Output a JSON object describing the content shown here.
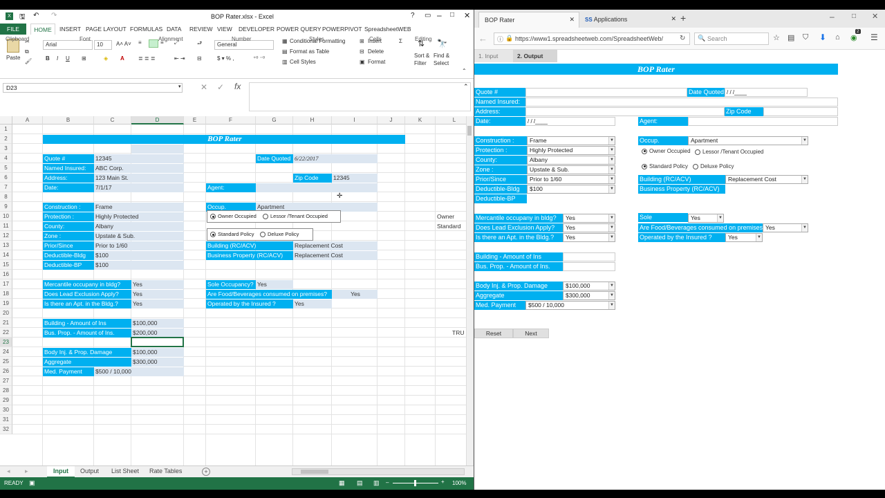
{
  "excel": {
    "window_title": "BOP Rater.xlsx - Excel",
    "ribbon_tabs": [
      "FILE",
      "HOME",
      "INSERT",
      "PAGE LAYOUT",
      "FORMULAS",
      "DATA",
      "REVIEW",
      "VIEW",
      "DEVELOPER",
      "POWER QUERY",
      "POWERPIVOT",
      "SpreadsheetWEB"
    ],
    "active_tab": "HOME",
    "font_name": "Arial",
    "font_size": "10",
    "number_format": "General",
    "groups": {
      "clipboard": "Clipboard",
      "font": "Font",
      "alignment": "Alignment",
      "number": "Number",
      "styles": "Styles",
      "cells": "Cells",
      "editing": "Editing"
    },
    "buttons": {
      "paste": "Paste",
      "conditional": "Conditional Formatting",
      "format_table": "Format as Table",
      "cell_styles": "Cell Styles",
      "insert": "Insert",
      "delete": "Delete",
      "format": "Format",
      "sort": "Sort &",
      "filter": "Filter",
      "find": "Find &",
      "select": "Select"
    },
    "name_box": "D23",
    "columns": [
      "A",
      "B",
      "C",
      "D",
      "E",
      "F",
      "G",
      "H",
      "I",
      "J",
      "K",
      "L"
    ],
    "rows": [
      "1",
      "2",
      "3",
      "4",
      "5",
      "6",
      "7",
      "8",
      "9",
      "10",
      "11",
      "12",
      "13",
      "14",
      "15",
      "16",
      "17",
      "18",
      "19",
      "20",
      "21",
      "22",
      "23",
      "24",
      "25",
      "26",
      "27",
      "28",
      "29",
      "30",
      "31",
      "32"
    ],
    "sheet": {
      "title": "BOP Rater",
      "quote_label": "Quote #",
      "quote_value": "12345",
      "named_label": "Named Insured:",
      "named_value": "ABC Corp.",
      "address_label": "Address:",
      "address_value": "123 Main St.",
      "date_label": "Date:",
      "date_value": "7/1/17",
      "date_quoted_label": "Date Quoted",
      "date_quoted_value": "6/22/2017",
      "zip_label": "Zip Code",
      "zip_value": "12345",
      "agent_label": "Agent:",
      "construction_label": "Construction :",
      "construction_value": "Frame",
      "protection_label": "Protection :",
      "protection_value": "Highly Protected",
      "county_label": "County:",
      "county_value": "Albany",
      "zone_label": "Zone :",
      "zone_value": "Upstate & Sub.",
      "prior_label": "Prior/Since",
      "prior_value": "Prior to 1/60",
      "ded_bldg_label": "Deductible-Bldg",
      "ded_bldg_value": "$100",
      "ded_bp_label": "Deductible-BP",
      "ded_bp_value": "$100",
      "occup_label": "Occup.",
      "occup_value": "Apartment",
      "owner_radio": "Owner Occupied",
      "lessor_radio": "Lessor /Tenant Occupied",
      "standard_radio": "Standard Policy",
      "deluxe_radio": "Deluxe Policy",
      "building_rc_label": "Building (RC/ACV)",
      "building_rc_value": "Replacement Cost",
      "bp_rc_label": "Business Property (RC/ACV)",
      "bp_rc_value": "Replacement Cost",
      "mercantile_label": "Mercantile occupany in bldg?",
      "mercantile_value": "Yes",
      "lead_label": "Does Lead Exclusion Apply?",
      "lead_value": "Yes",
      "apt_label": "Is there an Apt. in the Bldg.?",
      "apt_value": "Yes",
      "sole_label": "Sole Occupancy?",
      "sole_value": "Yes",
      "food_label": "Are Food/Beverages consumed on premises?",
      "food_value": "Yes",
      "operated_label": "Operated by  the Insured ?",
      "operated_value": "Yes",
      "bldg_amt_label": "Building - Amount of Ins",
      "bldg_amt_value": "$100,000",
      "bp_amt_label": "Bus. Prop. - Amount of Ins.",
      "bp_amt_value": "$200,000",
      "bi_label": "Body Inj. & Prop. Damage",
      "bi_value": "$100,000",
      "agg_label": "Aggregate",
      "agg_value": "$300,000",
      "med_label": "Med. Payment",
      "med_value": "$500 / 10,000",
      "l_owner": "Owner",
      "l_standard": "Standard",
      "l_true": "TRU"
    },
    "sheet_tabs": [
      "Input",
      "Output",
      "List Sheet",
      "Rate Tables"
    ],
    "active_sheet": "Input",
    "status_ready": "READY",
    "zoom": "100%"
  },
  "browser": {
    "tabs": [
      "BOP Rater",
      "Applications"
    ],
    "url": "https://www1.spreadsheetweb.com/SpreadsheetWeb/",
    "search_placeholder": "Search",
    "notif_count": "2",
    "page_tabs": [
      "1. Input",
      "2. Output"
    ],
    "title": "BOP Rater",
    "quote_label": "Quote #",
    "date_quoted_label": "Date Quoted",
    "date_quoted_value": "/ / /____",
    "named_label": "Named Insured:",
    "address_label": "Address:",
    "zip_label": "Zip Code",
    "date_label": "Date:",
    "date_value": "/ / /____",
    "agent_label": "Agent:",
    "construction_label": "Construction :",
    "construction_value": "Frame",
    "protection_label": "Protection :",
    "protection_value": "Highly Protected",
    "county_label": "County:",
    "county_value": "Albany",
    "zone_label": "Zone :",
    "zone_value": "Upstate & Sub.",
    "prior_label": "Prior/Since",
    "prior_value": "Prior to 1/60",
    "ded_bldg_label": "Deductible-Bldg",
    "ded_bldg_value": "$100",
    "ded_bp_label": "Deductible-BP",
    "occup_label": "Occup.",
    "occup_value": "Apartment",
    "owner_radio": "Owner Occupied",
    "lessor_radio": "Lessor /Tenant Occupied",
    "standard_radio": "Standard Policy",
    "deluxe_radio": "Deluxe Policy",
    "building_rc_label": "Building (RC/ACV)",
    "building_rc_value": "Replacement Cost",
    "bp_rc_label": "Business Property (RC/ACV)",
    "mercantile_label": "Mercantile occupany in bldg?",
    "mercantile_value": "Yes",
    "lead_label": "Does Lead Exclusion Apply?",
    "lead_value": "Yes",
    "apt_label": "Is there an Apt. in the Bldg.?",
    "apt_value": "Yes",
    "sole_label": "Sole",
    "sole_value": "Yes",
    "food_label": "Are Food/Beverages consumed on premises?",
    "food_value": "Yes",
    "operated_label": "Operated by  the Insured ?",
    "operated_value": "Yes",
    "bldg_amt_label": "Building - Amount of Ins",
    "bp_amt_label": "Bus. Prop. - Amount of Ins.",
    "bi_label": "Body Inj. & Prop. Damage",
    "bi_value": "$100,000",
    "agg_label": "Aggregate",
    "agg_value": "$300,000",
    "med_label": "Med. Payment",
    "med_value": "$500 / 10,000",
    "reset_label": "Reset",
    "next_label": "Next"
  },
  "colors": {
    "accent": "#00b0f0",
    "light_cell": "#dce6f1",
    "excel_green": "#217346"
  }
}
